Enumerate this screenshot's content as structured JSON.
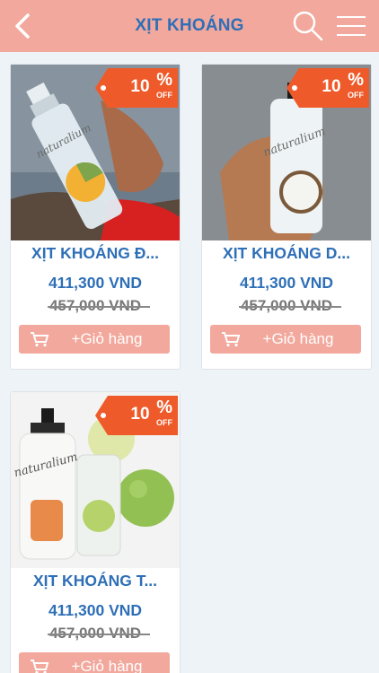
{
  "header": {
    "title": "XỊT KHOÁNG",
    "back_icon": "chevron-left-icon",
    "search_icon": "search-icon",
    "menu_icon": "hamburger-menu-icon",
    "background_color": "#f2a89c",
    "title_color": "#2e6fb7"
  },
  "products": [
    {
      "name": "XỊT KHOÁNG Đ...",
      "price": "411,300 VND",
      "old_price": "457,000 VND",
      "discount": "10",
      "discount_percent": "%",
      "discount_off": "OFF",
      "cart_label": "+Giỏ hàng",
      "brand": "naturalium"
    },
    {
      "name": "XỊT KHOÁNG D...",
      "price": "411,300 VND",
      "old_price": "457,000 VND",
      "discount": "10",
      "discount_percent": "%",
      "discount_off": "OFF",
      "cart_label": "+Giỏ hàng",
      "brand": "naturalium"
    },
    {
      "name": "XỊT KHOÁNG T...",
      "price": "411,300 VND",
      "old_price": "457,000 VND",
      "discount": "10",
      "discount_percent": "%",
      "discount_off": "OFF",
      "cart_label": "+Giỏ hàng",
      "brand": "naturalium"
    }
  ],
  "colors": {
    "accent": "#f2a89c",
    "tag": "#ef5a2a",
    "text_blue": "#2e6fb7",
    "background": "#eef3f8"
  }
}
